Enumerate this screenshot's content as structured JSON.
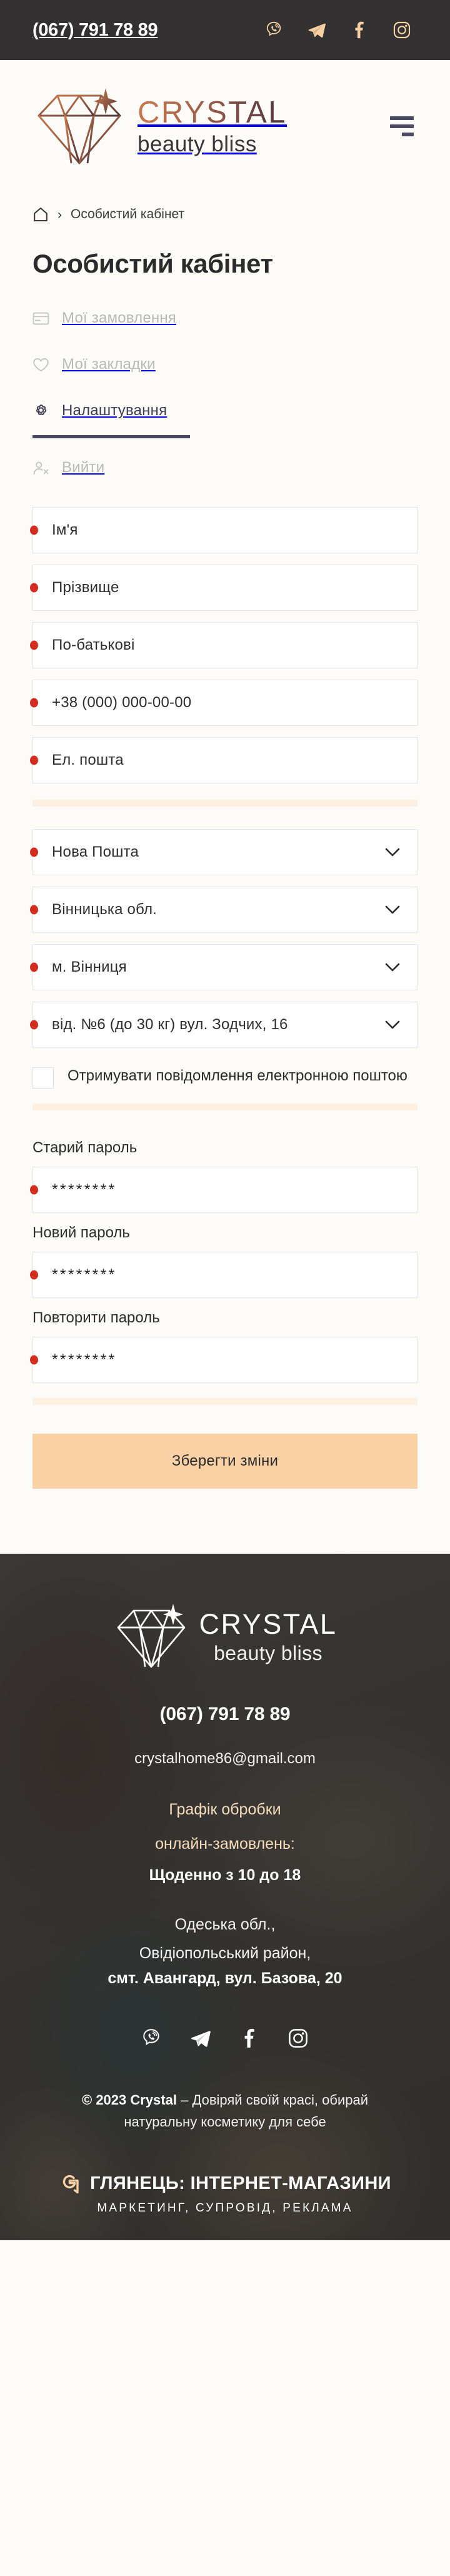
{
  "topbar": {
    "phone": "(067) 791 78 89",
    "socials": [
      {
        "name": "viber-icon",
        "label": "Viber"
      },
      {
        "name": "telegram-icon",
        "label": "Telegram"
      },
      {
        "name": "facebook-icon",
        "label": "Facebook"
      },
      {
        "name": "instagram-icon",
        "label": "Instagram"
      }
    ],
    "bg_color": "#333131",
    "icon_color": "#f6cfa3"
  },
  "header": {
    "logo_title": "CRYSTAL",
    "logo_tagline": "beauty bliss",
    "menu_label": "Меню"
  },
  "breadcrumb": {
    "home_label": "Головна",
    "separator": "›",
    "current": "Особистий кабінет"
  },
  "page": {
    "title": "Особистий кабінет"
  },
  "account_nav": {
    "items": [
      {
        "icon": "orders-card-icon",
        "label": "Мої замовлення",
        "active": false
      },
      {
        "icon": "heart-icon",
        "label": "Мої закладки",
        "active": false
      },
      {
        "icon": "gear-icon",
        "label": "Налаштування",
        "active": true
      },
      {
        "icon": "logout-user-icon",
        "label": "Вийти",
        "active": false
      }
    ],
    "active_underline_color": "#454561"
  },
  "form": {
    "personal_fields": [
      {
        "name": "first-name",
        "value": "Ім'я",
        "required": true
      },
      {
        "name": "last-name",
        "value": "Прізвище",
        "required": true
      },
      {
        "name": "middle-name",
        "value": "По-батькові",
        "required": true
      },
      {
        "name": "phone",
        "value": "+38 (000) 000-00-00",
        "required": true
      },
      {
        "name": "email",
        "value": "Ел. пошта",
        "required": true
      }
    ],
    "delivery_selects": [
      {
        "name": "carrier",
        "value": "Нова Пошта",
        "required": true
      },
      {
        "name": "region",
        "value": "Вінницька обл.",
        "required": true
      },
      {
        "name": "city",
        "value": "м. Вінниця",
        "required": true
      },
      {
        "name": "branch",
        "value": "від. №6 (до 30 кг) вул. Зодчих, 16",
        "required": true
      }
    ],
    "newsletter": {
      "label": "Отримувати повідомлення електронною поштою",
      "checked": false
    },
    "password_fields": [
      {
        "name": "old-password",
        "label": "Старий пароль",
        "value": "********",
        "required": true
      },
      {
        "name": "new-password",
        "label": "Новий пароль",
        "value": "********",
        "required": true
      },
      {
        "name": "repeat-password",
        "label": "Повторити пароль",
        "value": "********",
        "required": true
      }
    ],
    "save_label": "Зберегти зміни",
    "save_bg": "#fad2a6",
    "required_dot_color": "#d32b20",
    "divider_color": "#fdf0e1"
  },
  "footer": {
    "logo_title": "CRYSTAL",
    "logo_tagline": "beauty bliss",
    "phone": "(067) 791 78 89",
    "email": "crystalhome86@gmail.com",
    "schedule_title_line1": "Графік обробки",
    "schedule_title_line2": "онлайн-замовлень:",
    "schedule_value": "Щоденно з 10 до 18",
    "address_line1": "Одеська обл.,",
    "address_line2": "Овідіопольський район,",
    "address_line3": "смт. Авангард, вул. Базова, 20",
    "socials": [
      {
        "name": "viber-icon",
        "label": "Viber"
      },
      {
        "name": "telegram-icon",
        "label": "Telegram"
      },
      {
        "name": "facebook-icon",
        "label": "Facebook"
      },
      {
        "name": "instagram-icon",
        "label": "Instagram"
      }
    ],
    "copyright_year": "© 2023 Crystal",
    "copyright_rest": " – Довіряй своїй красі, обирай натуральну косметику для себе",
    "developer_name": "ГЛЯНЕЦЬ: ІНТЕРНЕТ-МАГАЗИНИ",
    "developer_sub": "МАРКЕТИНГ, СУПРОВІД, РЕКЛАМА",
    "accent_color": "#f6dcb9"
  }
}
